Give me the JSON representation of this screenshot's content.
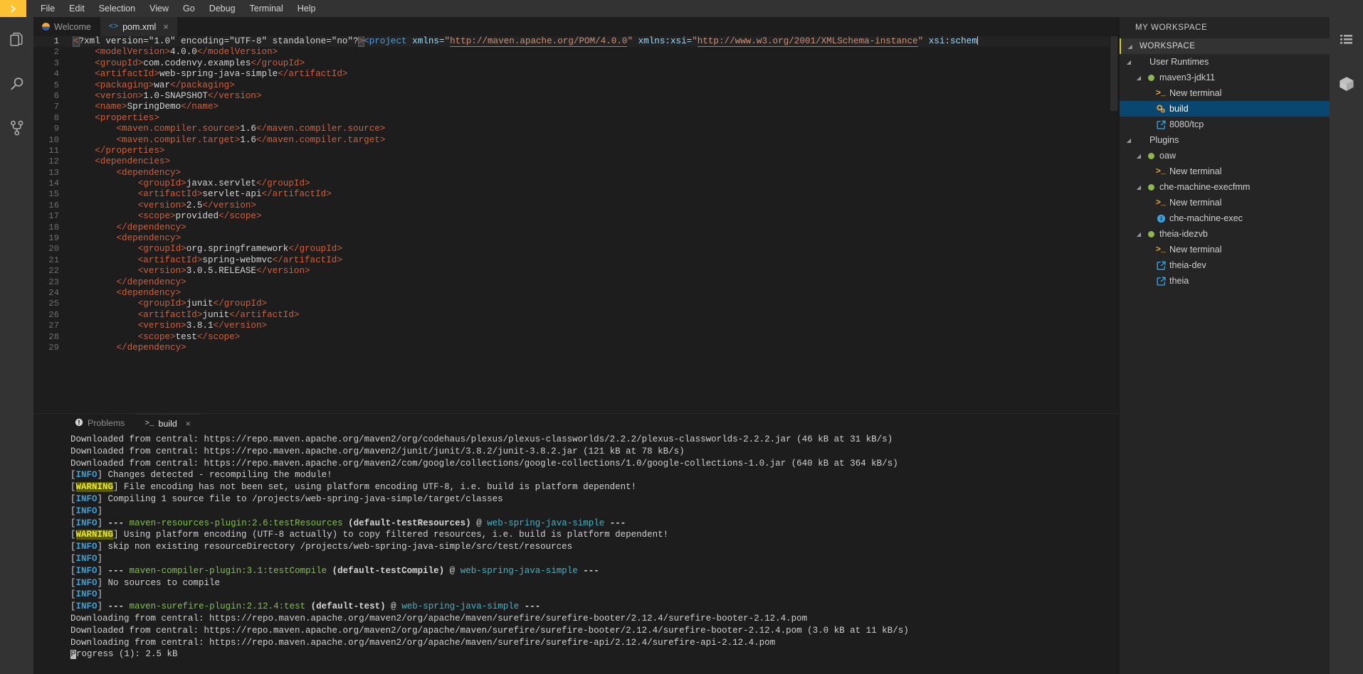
{
  "menubar": {
    "logo": "chevron-right-logo",
    "items": [
      "File",
      "Edit",
      "Selection",
      "View",
      "Go",
      "Debug",
      "Terminal",
      "Help"
    ]
  },
  "activitybar": {
    "items": [
      {
        "name": "files-icon",
        "label": "Explorer"
      },
      {
        "name": "search-icon",
        "label": "Search"
      },
      {
        "name": "source-control-icon",
        "label": "Source Control"
      }
    ]
  },
  "rightbar": {
    "items": [
      {
        "name": "outline-list-icon",
        "label": "Outline"
      },
      {
        "name": "cube-icon",
        "label": "Plugins"
      }
    ]
  },
  "editor": {
    "tabs": [
      {
        "label": "Welcome",
        "icon": "theia-logo-icon",
        "active": false,
        "closable": false
      },
      {
        "label": "pom.xml",
        "icon": "xml-file-icon",
        "active": true,
        "closable": true,
        "close": "×"
      }
    ],
    "lines": [
      {
        "n": "1",
        "cur": true,
        "indent": 0,
        "tokens": [
          {
            "t": "brk",
            "v": "<"
          },
          {
            "t": "pi",
            "v": "?xml version=\"1.0\" encoding=\"UTF-8\" standalone=\"no\"?"
          },
          {
            "t": "brk",
            "v": ">"
          },
          {
            "t": "tag2",
            "v": "<project "
          },
          {
            "t": "attr",
            "v": "xmlns="
          },
          {
            "t": "str",
            "v": "\""
          },
          {
            "t": "link",
            "v": "http://maven.apache.org/POM/4.0.0"
          },
          {
            "t": "str",
            "v": "\""
          },
          {
            "t": "txt",
            "v": " "
          },
          {
            "t": "attr",
            "v": "xmlns:xsi="
          },
          {
            "t": "str",
            "v": "\""
          },
          {
            "t": "link",
            "v": "http://www.w3.org/2001/XMLSchema-instance"
          },
          {
            "t": "str",
            "v": "\""
          },
          {
            "t": "txt",
            "v": " "
          },
          {
            "t": "attr",
            "v": "xsi:schem"
          },
          {
            "t": "caret",
            "v": ""
          }
        ]
      },
      {
        "n": "2",
        "indent": 4,
        "tokens": [
          {
            "t": "tag",
            "v": "<modelVersion>"
          },
          {
            "t": "txt",
            "v": "4.0.0"
          },
          {
            "t": "tag",
            "v": "</modelVersion>"
          }
        ]
      },
      {
        "n": "3",
        "indent": 4,
        "tokens": [
          {
            "t": "tag",
            "v": "<groupId>"
          },
          {
            "t": "txt",
            "v": "com.codenvy.examples"
          },
          {
            "t": "tag",
            "v": "</groupId>"
          }
        ]
      },
      {
        "n": "4",
        "indent": 4,
        "tokens": [
          {
            "t": "tag",
            "v": "<artifactId>"
          },
          {
            "t": "txt",
            "v": "web-spring-java-simple"
          },
          {
            "t": "tag",
            "v": "</artifactId>"
          }
        ]
      },
      {
        "n": "5",
        "indent": 4,
        "tokens": [
          {
            "t": "tag",
            "v": "<packaging>"
          },
          {
            "t": "txt",
            "v": "war"
          },
          {
            "t": "tag",
            "v": "</packaging>"
          }
        ]
      },
      {
        "n": "6",
        "indent": 4,
        "tokens": [
          {
            "t": "tag",
            "v": "<version>"
          },
          {
            "t": "txt",
            "v": "1.0-SNAPSHOT"
          },
          {
            "t": "tag",
            "v": "</version>"
          }
        ]
      },
      {
        "n": "7",
        "indent": 4,
        "tokens": [
          {
            "t": "tag",
            "v": "<name>"
          },
          {
            "t": "txt",
            "v": "SpringDemo"
          },
          {
            "t": "tag",
            "v": "</name>"
          }
        ]
      },
      {
        "n": "8",
        "indent": 4,
        "tokens": [
          {
            "t": "tag",
            "v": "<properties>"
          }
        ]
      },
      {
        "n": "9",
        "indent": 8,
        "tokens": [
          {
            "t": "tag",
            "v": "<maven.compiler.source>"
          },
          {
            "t": "txt",
            "v": "1.6"
          },
          {
            "t": "tag",
            "v": "</maven.compiler.source>"
          }
        ]
      },
      {
        "n": "10",
        "indent": 8,
        "tokens": [
          {
            "t": "tag",
            "v": "<maven.compiler.target>"
          },
          {
            "t": "txt",
            "v": "1.6"
          },
          {
            "t": "tag",
            "v": "</maven.compiler.target>"
          }
        ]
      },
      {
        "n": "11",
        "indent": 4,
        "tokens": [
          {
            "t": "tag",
            "v": "</properties>"
          }
        ]
      },
      {
        "n": "12",
        "indent": 4,
        "tokens": [
          {
            "t": "tag",
            "v": "<dependencies>"
          }
        ]
      },
      {
        "n": "13",
        "indent": 8,
        "tokens": [
          {
            "t": "tag",
            "v": "<dependency>"
          }
        ]
      },
      {
        "n": "14",
        "indent": 12,
        "tokens": [
          {
            "t": "tag",
            "v": "<groupId>"
          },
          {
            "t": "txt",
            "v": "javax.servlet"
          },
          {
            "t": "tag",
            "v": "</groupId>"
          }
        ]
      },
      {
        "n": "15",
        "indent": 12,
        "tokens": [
          {
            "t": "tag",
            "v": "<artifactId>"
          },
          {
            "t": "txt",
            "v": "servlet-api"
          },
          {
            "t": "tag",
            "v": "</artifactId>"
          }
        ]
      },
      {
        "n": "16",
        "indent": 12,
        "tokens": [
          {
            "t": "tag",
            "v": "<version>"
          },
          {
            "t": "txt",
            "v": "2.5"
          },
          {
            "t": "tag",
            "v": "</version>"
          }
        ]
      },
      {
        "n": "17",
        "indent": 12,
        "tokens": [
          {
            "t": "tag",
            "v": "<scope>"
          },
          {
            "t": "txt",
            "v": "provided"
          },
          {
            "t": "tag",
            "v": "</scope>"
          }
        ]
      },
      {
        "n": "18",
        "indent": 8,
        "tokens": [
          {
            "t": "tag",
            "v": "</dependency>"
          }
        ]
      },
      {
        "n": "19",
        "indent": 8,
        "tokens": [
          {
            "t": "tag",
            "v": "<dependency>"
          }
        ]
      },
      {
        "n": "20",
        "indent": 12,
        "tokens": [
          {
            "t": "tag",
            "v": "<groupId>"
          },
          {
            "t": "txt",
            "v": "org.springframework"
          },
          {
            "t": "tag",
            "v": "</groupId>"
          }
        ]
      },
      {
        "n": "21",
        "indent": 12,
        "tokens": [
          {
            "t": "tag",
            "v": "<artifactId>"
          },
          {
            "t": "txt",
            "v": "spring-webmvc"
          },
          {
            "t": "tag",
            "v": "</artifactId>"
          }
        ]
      },
      {
        "n": "22",
        "indent": 12,
        "tokens": [
          {
            "t": "tag",
            "v": "<version>"
          },
          {
            "t": "txt",
            "v": "3.0.5.RELEASE"
          },
          {
            "t": "tag",
            "v": "</version>"
          }
        ]
      },
      {
        "n": "23",
        "indent": 8,
        "tokens": [
          {
            "t": "tag",
            "v": "</dependency>"
          }
        ]
      },
      {
        "n": "24",
        "indent": 8,
        "tokens": [
          {
            "t": "tag",
            "v": "<dependency>"
          }
        ]
      },
      {
        "n": "25",
        "indent": 12,
        "tokens": [
          {
            "t": "tag",
            "v": "<groupId>"
          },
          {
            "t": "txt",
            "v": "junit"
          },
          {
            "t": "tag",
            "v": "</groupId>"
          }
        ]
      },
      {
        "n": "26",
        "indent": 12,
        "tokens": [
          {
            "t": "tag",
            "v": "<artifactId>"
          },
          {
            "t": "txt",
            "v": "junit"
          },
          {
            "t": "tag",
            "v": "</artifactId>"
          }
        ]
      },
      {
        "n": "27",
        "indent": 12,
        "tokens": [
          {
            "t": "tag",
            "v": "<version>"
          },
          {
            "t": "txt",
            "v": "3.8.1"
          },
          {
            "t": "tag",
            "v": "</version>"
          }
        ]
      },
      {
        "n": "28",
        "indent": 12,
        "tokens": [
          {
            "t": "tag",
            "v": "<scope>"
          },
          {
            "t": "txt",
            "v": "test"
          },
          {
            "t": "tag",
            "v": "</scope>"
          }
        ]
      },
      {
        "n": "29",
        "indent": 8,
        "tokens": [
          {
            "t": "tag",
            "v": "</dependency>"
          }
        ]
      }
    ]
  },
  "panel": {
    "tabs": [
      {
        "label": "Problems",
        "icon": "problems-icon",
        "active": false,
        "closable": false
      },
      {
        "label": "build",
        "icon": "terminal-icon",
        "active": true,
        "closable": true,
        "close": "×"
      }
    ],
    "terminal_lines": [
      [
        {
          "c": "plain",
          "v": "Downloaded from central: https://repo.maven.apache.org/maven2/org/codehaus/plexus/plexus-classworlds/2.2.2/plexus-classworlds-2.2.2.jar (46 kB at 31 kB/s)"
        }
      ],
      [
        {
          "c": "plain",
          "v": "Downloaded from central: https://repo.maven.apache.org/maven2/junit/junit/3.8.2/junit-3.8.2.jar (121 kB at 78 kB/s)"
        }
      ],
      [
        {
          "c": "plain",
          "v": "Downloaded from central: https://repo.maven.apache.org/maven2/com/google/collections/google-collections/1.0/google-collections-1.0.jar (640 kB at 364 kB/s)"
        }
      ],
      [
        {
          "c": "plain",
          "v": "["
        },
        {
          "c": "info",
          "v": "INFO"
        },
        {
          "c": "plain",
          "v": "] Changes detected - recompiling the module!"
        }
      ],
      [
        {
          "c": "plain",
          "v": "["
        },
        {
          "c": "warn",
          "v": "WARNING"
        },
        {
          "c": "plain",
          "v": "] File encoding has not been set, using platform encoding UTF-8, i.e. build is platform dependent!"
        }
      ],
      [
        {
          "c": "plain",
          "v": "["
        },
        {
          "c": "info",
          "v": "INFO"
        },
        {
          "c": "plain",
          "v": "] Compiling 1 source file to /projects/web-spring-java-simple/target/classes"
        }
      ],
      [
        {
          "c": "plain",
          "v": "["
        },
        {
          "c": "info",
          "v": "INFO"
        },
        {
          "c": "plain",
          "v": "] "
        }
      ],
      [
        {
          "c": "plain",
          "v": "["
        },
        {
          "c": "info",
          "v": "INFO"
        },
        {
          "c": "plain",
          "v": "] "
        },
        {
          "c": "dash",
          "v": "---"
        },
        {
          "c": "plain",
          "v": " "
        },
        {
          "c": "plugin",
          "v": "maven-resources-plugin:2.6:testResources"
        },
        {
          "c": "plain",
          "v": " "
        },
        {
          "c": "goal",
          "v": "(default-testResources)"
        },
        {
          "c": "plain",
          "v": " @ "
        },
        {
          "c": "proj",
          "v": "web-spring-java-simple"
        },
        {
          "c": "plain",
          "v": " "
        },
        {
          "c": "dash",
          "v": "---"
        }
      ],
      [
        {
          "c": "plain",
          "v": "["
        },
        {
          "c": "warn",
          "v": "WARNING"
        },
        {
          "c": "plain",
          "v": "] Using platform encoding (UTF-8 actually) to copy filtered resources, i.e. build is platform dependent!"
        }
      ],
      [
        {
          "c": "plain",
          "v": "["
        },
        {
          "c": "info",
          "v": "INFO"
        },
        {
          "c": "plain",
          "v": "] skip non existing resourceDirectory /projects/web-spring-java-simple/src/test/resources"
        }
      ],
      [
        {
          "c": "plain",
          "v": "["
        },
        {
          "c": "info",
          "v": "INFO"
        },
        {
          "c": "plain",
          "v": "] "
        }
      ],
      [
        {
          "c": "plain",
          "v": "["
        },
        {
          "c": "info",
          "v": "INFO"
        },
        {
          "c": "plain",
          "v": "] "
        },
        {
          "c": "dash",
          "v": "---"
        },
        {
          "c": "plain",
          "v": " "
        },
        {
          "c": "plugin",
          "v": "maven-compiler-plugin:3.1:testCompile"
        },
        {
          "c": "plain",
          "v": " "
        },
        {
          "c": "goal",
          "v": "(default-testCompile)"
        },
        {
          "c": "plain",
          "v": " @ "
        },
        {
          "c": "proj",
          "v": "web-spring-java-simple"
        },
        {
          "c": "plain",
          "v": " "
        },
        {
          "c": "dash",
          "v": "---"
        }
      ],
      [
        {
          "c": "plain",
          "v": "["
        },
        {
          "c": "info",
          "v": "INFO"
        },
        {
          "c": "plain",
          "v": "] No sources to compile"
        }
      ],
      [
        {
          "c": "plain",
          "v": "["
        },
        {
          "c": "info",
          "v": "INFO"
        },
        {
          "c": "plain",
          "v": "] "
        }
      ],
      [
        {
          "c": "plain",
          "v": "["
        },
        {
          "c": "info",
          "v": "INFO"
        },
        {
          "c": "plain",
          "v": "] "
        },
        {
          "c": "dash",
          "v": "---"
        },
        {
          "c": "plain",
          "v": " "
        },
        {
          "c": "plugin",
          "v": "maven-surefire-plugin:2.12.4:test"
        },
        {
          "c": "plain",
          "v": " "
        },
        {
          "c": "goal",
          "v": "(default-test)"
        },
        {
          "c": "plain",
          "v": " @ "
        },
        {
          "c": "proj",
          "v": "web-spring-java-simple"
        },
        {
          "c": "plain",
          "v": " "
        },
        {
          "c": "dash",
          "v": "---"
        }
      ],
      [
        {
          "c": "plain",
          "v": "Downloading from central: https://repo.maven.apache.org/maven2/org/apache/maven/surefire/surefire-booter/2.12.4/surefire-booter-2.12.4.pom"
        }
      ],
      [
        {
          "c": "plain",
          "v": "Downloaded from central: https://repo.maven.apache.org/maven2/org/apache/maven/surefire/surefire-booter/2.12.4/surefire-booter-2.12.4.pom (3.0 kB at 11 kB/s)"
        }
      ],
      [
        {
          "c": "plain",
          "v": "Downloading from central: https://repo.maven.apache.org/maven2/org/apache/maven/surefire/surefire-api/2.12.4/surefire-api-2.12.4.pom"
        }
      ],
      [
        {
          "c": "caret",
          "v": "P"
        },
        {
          "c": "plain",
          "v": "rogress (1): 2.5 kB"
        }
      ]
    ]
  },
  "workspace": {
    "title": "MY WORKSPACE",
    "section_label": "WORKSPACE",
    "tree": [
      {
        "label": "User Runtimes",
        "depth": 0,
        "twisty": "◢",
        "icon": "none",
        "selected": false
      },
      {
        "label": "maven3-jdk11",
        "depth": 1,
        "twisty": "◢",
        "icon": "status-dot",
        "selected": false
      },
      {
        "label": "New terminal",
        "depth": 2,
        "twisty": "",
        "icon": "terminal-icon",
        "selected": false
      },
      {
        "label": "build",
        "depth": 2,
        "twisty": "",
        "icon": "gear-icon",
        "selected": true
      },
      {
        "label": "8080/tcp",
        "depth": 2,
        "twisty": "",
        "icon": "link-icon",
        "selected": false
      },
      {
        "label": "Plugins",
        "depth": 0,
        "twisty": "◢",
        "icon": "none",
        "selected": false
      },
      {
        "label": "oaw",
        "depth": 1,
        "twisty": "◢",
        "icon": "status-dot",
        "selected": false
      },
      {
        "label": "New terminal",
        "depth": 2,
        "twisty": "",
        "icon": "terminal-icon",
        "selected": false
      },
      {
        "label": "che-machine-execfmm",
        "depth": 1,
        "twisty": "◢",
        "icon": "status-dot",
        "selected": false
      },
      {
        "label": "New terminal",
        "depth": 2,
        "twisty": "",
        "icon": "terminal-icon",
        "selected": false
      },
      {
        "label": "che-machine-exec",
        "depth": 2,
        "twisty": "",
        "icon": "info-icon",
        "selected": false
      },
      {
        "label": "theia-idezvb",
        "depth": 1,
        "twisty": "◢",
        "icon": "status-dot",
        "selected": false
      },
      {
        "label": "New terminal",
        "depth": 2,
        "twisty": "",
        "icon": "terminal-icon",
        "selected": false
      },
      {
        "label": "theia-dev",
        "depth": 2,
        "twisty": "",
        "icon": "link-icon",
        "selected": false
      },
      {
        "label": "theia",
        "depth": 2,
        "twisty": "",
        "icon": "link-icon",
        "selected": false
      }
    ]
  },
  "colors": {
    "accent_yellow": "#fdc134",
    "selection_blue": "#094771",
    "status_green": "#8cb84c",
    "terminal_info": "#3b9fd6",
    "terminal_warning": "#e8e82c"
  }
}
